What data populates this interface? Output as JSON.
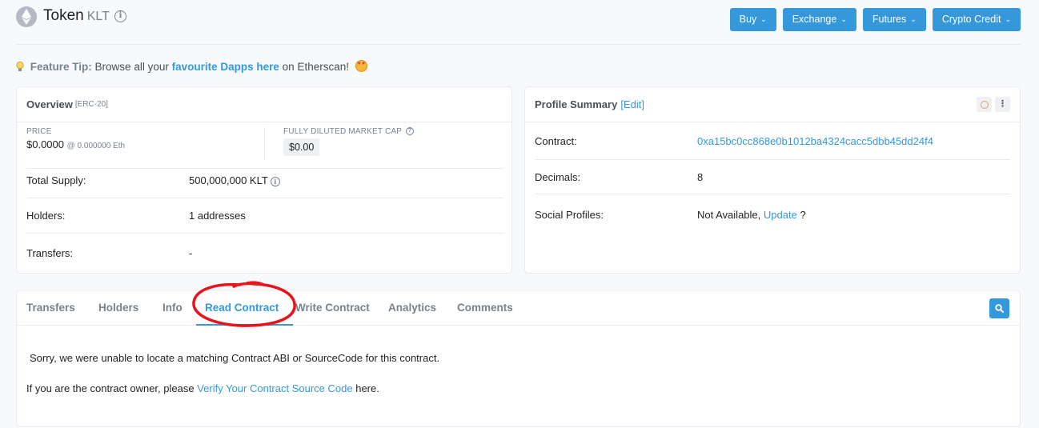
{
  "header": {
    "title": "Token",
    "symbol": "KLT",
    "buttons": [
      {
        "label": "Buy"
      },
      {
        "label": "Exchange"
      },
      {
        "label": "Futures"
      },
      {
        "label": "Crypto Credit"
      }
    ]
  },
  "tip": {
    "label": "Feature Tip:",
    "text_before": "Browse all your",
    "link": "favourite Dapps here",
    "text_after": "on Etherscan!"
  },
  "overview": {
    "title": "Overview",
    "subtitle": "[ERC-20]",
    "price_label": "PRICE",
    "price_value": "$0.0000",
    "price_eth": "@ 0.000000 Eth",
    "mcap_label": "FULLY DILUTED MARKET CAP",
    "mcap_value": "$0.00",
    "rows": [
      {
        "key": "Total Supply:",
        "value": "500,000,000 KLT"
      },
      {
        "key": "Holders:",
        "value": "1 addresses"
      },
      {
        "key": "Transfers:",
        "value": "-"
      }
    ]
  },
  "profile": {
    "title": "Profile Summary",
    "edit": "[Edit]",
    "contract_key": "Contract:",
    "contract_value": "0xa15bc0cc868e0b1012ba4324cacc5dbb45dd24f4",
    "decimals_key": "Decimals:",
    "decimals_value": "8",
    "social_key": "Social Profiles:",
    "social_text": "Not Available,",
    "social_link": "Update",
    "social_suffix": "?"
  },
  "tabs": [
    {
      "label": "Transfers"
    },
    {
      "label": "Holders"
    },
    {
      "label": "Info"
    },
    {
      "label": "Read Contract"
    },
    {
      "label": "Write Contract"
    },
    {
      "label": "Analytics"
    },
    {
      "label": "Comments"
    }
  ],
  "content": {
    "message1": "Sorry, we were unable to locate a matching Contract ABI or SourceCode for this contract.",
    "message2_before": "If you are the contract owner, please",
    "message2_link": "Verify Your Contract Source Code",
    "message2_after": "here."
  },
  "colors": {
    "primary": "#3498db",
    "annotation": "#e8141b"
  }
}
